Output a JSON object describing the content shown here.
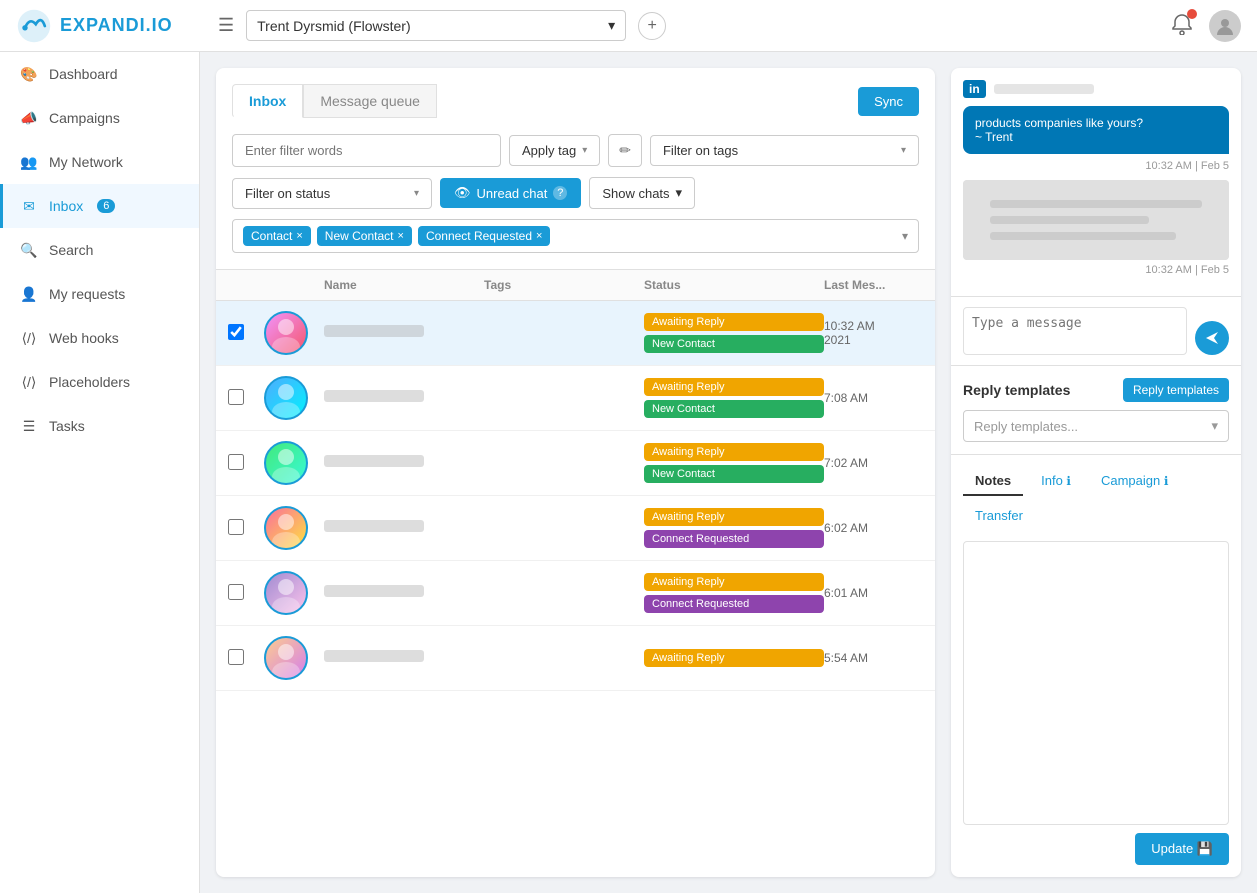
{
  "topnav": {
    "logo_text": "EXPANDI.IO",
    "account_name": "Trent Dyrsmid (Flowster)",
    "hamburger_icon": "☰",
    "add_icon": "+"
  },
  "sidebar": {
    "items": [
      {
        "label": "Dashboard",
        "icon": "🎨",
        "active": false
      },
      {
        "label": "Campaigns",
        "icon": "📣",
        "active": false
      },
      {
        "label": "My Network",
        "icon": "👥",
        "active": false
      },
      {
        "label": "Inbox",
        "icon": "✉",
        "active": true,
        "badge": "6"
      },
      {
        "label": "Search",
        "icon": "🔍",
        "active": false
      },
      {
        "label": "My requests",
        "icon": "👤",
        "active": false
      },
      {
        "label": "Web hooks",
        "icon": "⟨/⟩",
        "active": false
      },
      {
        "label": "Placeholders",
        "icon": "⟨/⟩",
        "active": false
      },
      {
        "label": "Tasks",
        "icon": "☰",
        "active": false
      }
    ]
  },
  "inbox": {
    "tabs": [
      {
        "label": "Inbox",
        "active": true
      },
      {
        "label": "Message queue",
        "active": false
      }
    ],
    "sync_btn": "Sync",
    "filter_placeholder": "Enter filter words",
    "apply_tag_btn": "Apply tag",
    "filter_tags_btn": "Filter on tags",
    "filter_status_btn": "Filter on status",
    "unread_btn": "Unread chat",
    "show_chats_btn": "Show chats",
    "active_tags": [
      {
        "label": "Contact"
      },
      {
        "label": "New Contact"
      },
      {
        "label": "Connect Requested"
      }
    ],
    "table": {
      "columns": [
        "",
        "",
        "Name",
        "Tags",
        "Status",
        "Last Mes..."
      ],
      "rows": [
        {
          "selected": true,
          "status_badges": [
            "Awaiting Reply",
            "New Contact"
          ],
          "status_colors": [
            "yellow",
            "green"
          ],
          "time": "10:32 AM 2021",
          "avatar_class": "avatar-1"
        },
        {
          "selected": false,
          "status_badges": [
            "Awaiting Reply",
            "New Contact"
          ],
          "status_colors": [
            "yellow",
            "green"
          ],
          "time": "7:08 AM",
          "avatar_class": "avatar-2"
        },
        {
          "selected": false,
          "status_badges": [
            "Awaiting Reply",
            "New Contact"
          ],
          "status_colors": [
            "yellow",
            "green"
          ],
          "time": "7:02 AM",
          "avatar_class": "avatar-3"
        },
        {
          "selected": false,
          "status_badges": [
            "Awaiting Reply",
            "Connect Requested"
          ],
          "status_colors": [
            "yellow",
            "purple"
          ],
          "time": "6:02 AM",
          "avatar_class": "avatar-4"
        },
        {
          "selected": false,
          "status_badges": [
            "Awaiting Reply",
            "Connect Requested"
          ],
          "status_colors": [
            "yellow",
            "purple"
          ],
          "time": "6:01 AM",
          "avatar_class": "avatar-5"
        },
        {
          "selected": false,
          "status_badges": [
            "Awaiting Reply"
          ],
          "status_colors": [
            "yellow"
          ],
          "time": "5:54 AM",
          "avatar_class": "avatar-6"
        }
      ]
    }
  },
  "right_panel": {
    "linkedin_label": "in",
    "chat_bubble_text": "products companies like yours?",
    "trent_sign": "~ Trent",
    "chat_time_1": "10:32 AM | Feb 5",
    "chat_time_2": "10:32 AM | Feb 5",
    "message_placeholder": "Type a message",
    "reply_templates_title": "Reply templates",
    "reply_templates_btn": "Reply templates",
    "reply_templates_placeholder": "Reply templates...",
    "notes_tabs": [
      {
        "label": "Notes",
        "active": true
      },
      {
        "label": "Info ℹ",
        "active": false,
        "blue": false
      },
      {
        "label": "Campaign ℹ",
        "active": false,
        "blue": true
      },
      {
        "label": "Transfer",
        "active": false,
        "blue": true
      }
    ],
    "update_btn": "Update 💾"
  }
}
